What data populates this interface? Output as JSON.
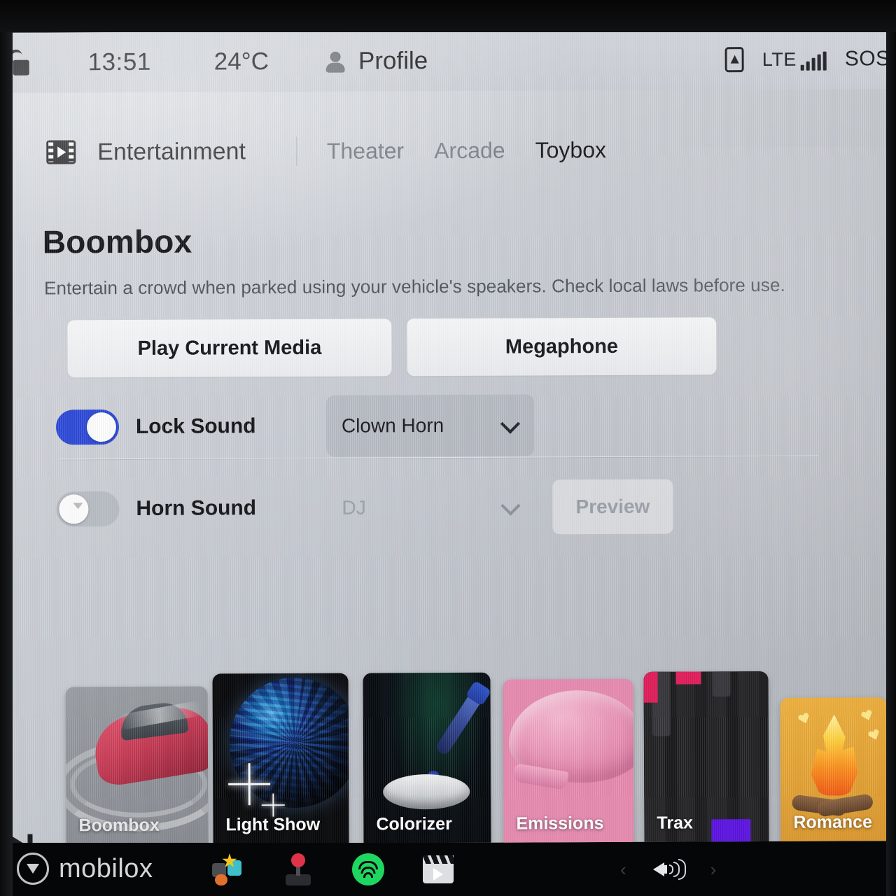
{
  "status_bar": {
    "lock_icon": "unlock-icon",
    "time": "13:51",
    "temperature": "24°C",
    "profile_icon": "person-icon",
    "profile_label": "Profile",
    "nav_icon": "phone-nav-icon",
    "network": "LTE",
    "signal_icon": "signal-bars-icon",
    "sos_label": "SOS"
  },
  "tabs": {
    "app_icon": "film-strip-icon",
    "app_label": "Entertainment",
    "items": [
      {
        "label": "Theater",
        "active": false
      },
      {
        "label": "Arcade",
        "active": false
      },
      {
        "label": "Toybox",
        "active": true
      }
    ]
  },
  "main": {
    "title": "Boombox",
    "subtitle": "Entertain a crowd when parked using your vehicle's speakers. Check local laws before use.",
    "buttons": {
      "play_current_media": "Play Current Media",
      "megaphone": "Megaphone"
    },
    "rows": [
      {
        "label": "Lock Sound",
        "toggle_state": "on",
        "dropdown_value": "Clown Horn",
        "dropdown_icon": "chevron-down-icon",
        "enabled": true
      },
      {
        "label": "Horn Sound",
        "toggle_state": "off",
        "dropdown_value": "DJ",
        "dropdown_icon": "chevron-down-icon",
        "enabled": false,
        "preview_label": "Preview"
      }
    ]
  },
  "cards": [
    {
      "label": "Boombox",
      "selected": true
    },
    {
      "label": "Light Show",
      "selected": false
    },
    {
      "label": "Colorizer",
      "selected": false
    },
    {
      "label": "Emissions",
      "selected": false
    },
    {
      "label": "Trax",
      "selected": false
    },
    {
      "label": "Romance",
      "selected": false
    }
  ],
  "dock": {
    "icons": [
      "toybox-icon",
      "arcade-joystick-icon",
      "spotify-icon",
      "entertainment-icon"
    ],
    "volume_icon": "speaker-volume-icon",
    "prev_chevron": "‹",
    "next_chevron": "›"
  },
  "media_control": {
    "skip_next_icon": "skip-next-icon"
  },
  "watermark": {
    "icon": "mobilox-logo-icon",
    "text": "mobilox"
  },
  "colors": {
    "toggle_on": "#2f4bd8",
    "toggle_off": "#b9bdc4",
    "screen_bg": "#c7cbd2",
    "accent_text": "#14161a",
    "emissions_pink": "#e78ab0",
    "romance_orange": "#e2a033",
    "spotify_green": "#1ed760"
  }
}
